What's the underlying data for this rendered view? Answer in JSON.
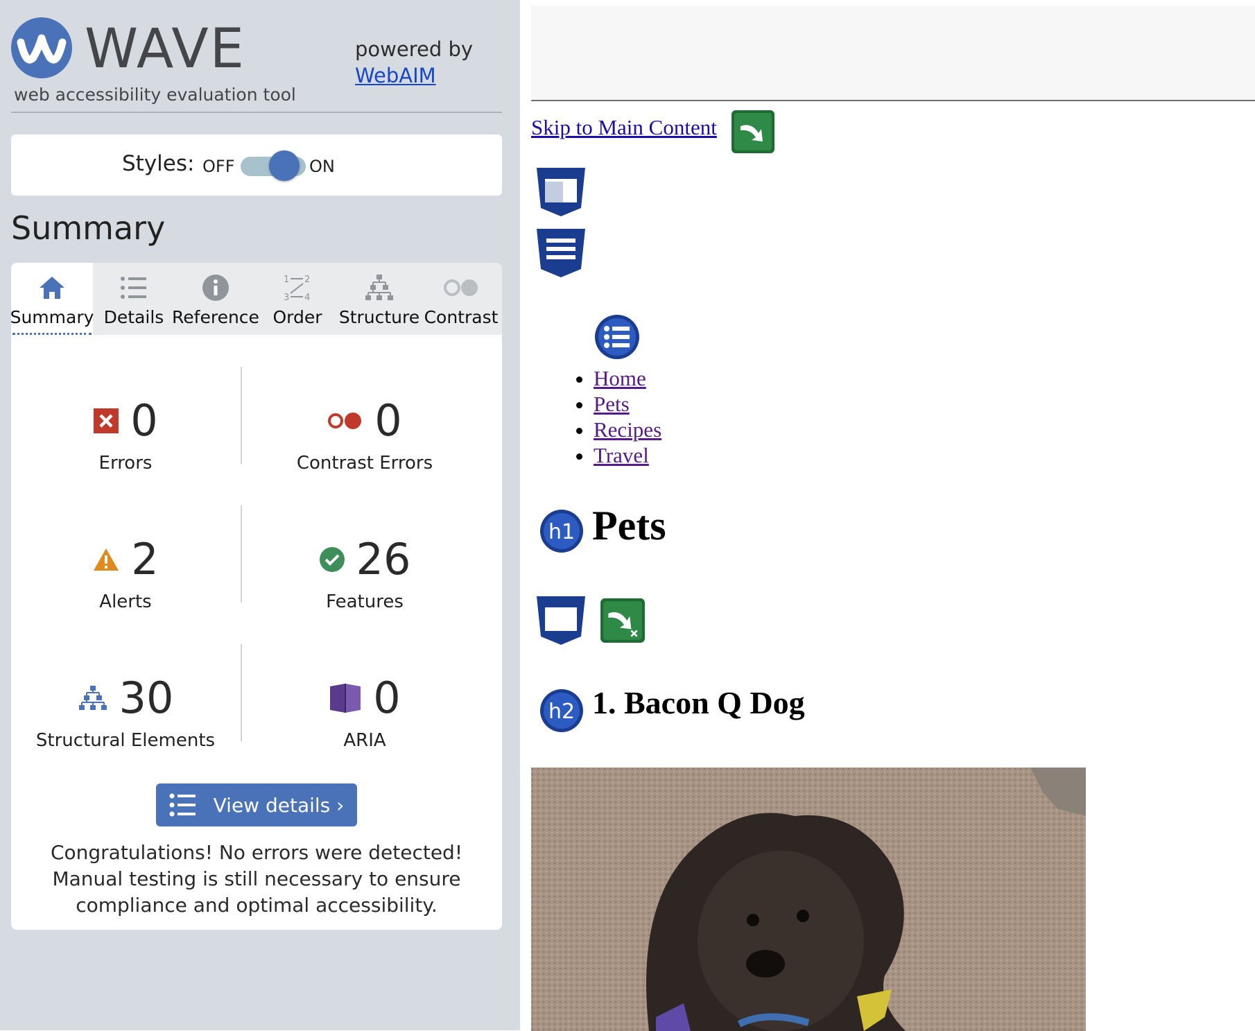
{
  "wave": {
    "logo_word": "WAVE",
    "tagline": "web accessibility evaluation tool",
    "powered_by": "powered by",
    "webaim_link": "WebAIM",
    "styles_label": "Styles:",
    "styles_off": "OFF",
    "styles_on": "ON",
    "summary_heading": "Summary",
    "tabs": [
      {
        "label": "Summary",
        "icon": "home-icon",
        "active": true
      },
      {
        "label": "Details",
        "icon": "list-icon"
      },
      {
        "label": "Reference",
        "icon": "info-icon"
      },
      {
        "label": "Order",
        "icon": "order-icon"
      },
      {
        "label": "Structure",
        "icon": "structure-icon"
      },
      {
        "label": "Contrast",
        "icon": "contrast-icon"
      }
    ],
    "stats": {
      "errors": {
        "count": "0",
        "label": "Errors"
      },
      "contrast_errors": {
        "count": "0",
        "label": "Contrast Errors"
      },
      "alerts": {
        "count": "2",
        "label": "Alerts"
      },
      "features": {
        "count": "26",
        "label": "Features"
      },
      "structural": {
        "count": "30",
        "label": "Structural Elements"
      },
      "aria": {
        "count": "0",
        "label": "ARIA"
      }
    },
    "view_details": "View details ›",
    "congrats": "Congratulations! No errors were detected! Manual testing is still necessary to ensure compliance and optimal accessibility."
  },
  "page": {
    "skip_link": "Skip to Main Content",
    "nav": [
      "Home",
      "Pets",
      "Recipes",
      "Travel"
    ],
    "h1_badge": "h1",
    "h1": "Pets",
    "h2_badge": "h2",
    "h2": "1. Bacon Q Dog"
  },
  "colors": {
    "wave_blue": "#4a72b8",
    "sidebar_bg": "#d5dbe0",
    "error_red": "#c0392b",
    "alert_orange": "#e08a1e",
    "feature_green": "#3e8e5a",
    "aria_purple": "#5a3a8c",
    "link_blue": "#1a0dab",
    "visited_purple": "#551a8b"
  }
}
